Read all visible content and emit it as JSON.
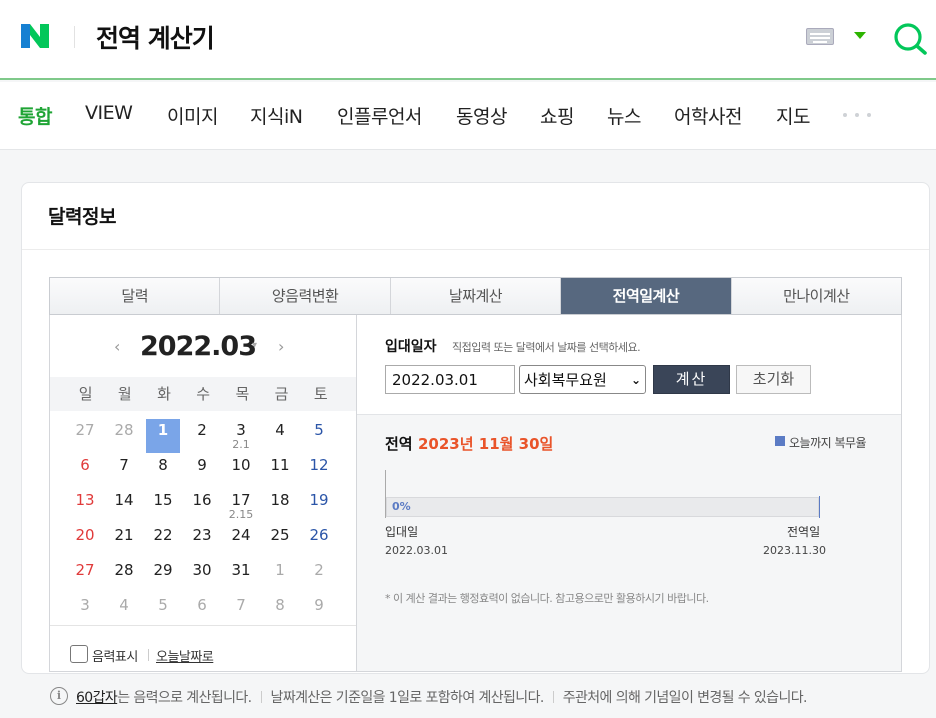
{
  "header": {
    "title": "전역 계산기",
    "brand_color": "#03c75a",
    "icons": [
      "naver-logo-icon",
      "keyboard-icon",
      "chevron-down-icon",
      "search-icon"
    ]
  },
  "nav": {
    "items": [
      "통합",
      "VIEW",
      "이미지",
      "지식iN",
      "인플루언서",
      "동영상",
      "쇼핑",
      "뉴스",
      "어학사전",
      "지도"
    ],
    "active": "통합"
  },
  "card": {
    "title": "달력정보"
  },
  "tabs": {
    "items": [
      "달력",
      "양음력변환",
      "날짜계산",
      "전역일계산",
      "만나이계산"
    ],
    "active": "전역일계산"
  },
  "calendar": {
    "month": "2022.03",
    "weekdays": [
      "일",
      "월",
      "화",
      "수",
      "목",
      "금",
      "토"
    ],
    "weeks": [
      [
        "27",
        "28",
        "1",
        "2",
        "3",
        "4",
        "5"
      ],
      [
        "6",
        "7",
        "8",
        "9",
        "10",
        "11",
        "12"
      ],
      [
        "13",
        "14",
        "15",
        "16",
        "17",
        "18",
        "19"
      ],
      [
        "20",
        "21",
        "22",
        "23",
        "24",
        "25",
        "26"
      ],
      [
        "27",
        "28",
        "29",
        "30",
        "31",
        "1",
        "2"
      ],
      [
        "3",
        "4",
        "5",
        "6",
        "7",
        "8",
        "9"
      ]
    ],
    "lunar_notes": {
      "3": "2.1",
      "17": "2.15"
    },
    "selected_day": "1",
    "lunar_toggle_label": "음력표시",
    "today_link": "오늘날짜로"
  },
  "form": {
    "label": "입대일자",
    "hint": "직접입력 또는 달력에서 날짜를 선택하세요.",
    "date_value": "2022.03.01",
    "service_type": "사회복무요원",
    "calc_button": "계산",
    "reset_button": "초기화"
  },
  "result": {
    "label": "전역",
    "discharge_date": "2023년 11월 30일",
    "legend": "오늘까지 복무율",
    "progress_percent": 0,
    "progress_text": "0%",
    "start_label": "입대일",
    "end_label": "전역일",
    "start_date": "2022.03.01",
    "end_date": "2023.11.30",
    "disclaimer": "* 이 계산 결과는 행정효력이 없습니다. 참고용으로만 활용하시기 바랍니다."
  },
  "info": {
    "link_text": "60갑자",
    "text1": "는 음력으로 계산됩니다.",
    "text2": "날짜계산은 기준일을 1일로 포함하여 계산됩니다.",
    "text3": "주관처에 의해 기념일이 변경될 수 있습니다."
  }
}
